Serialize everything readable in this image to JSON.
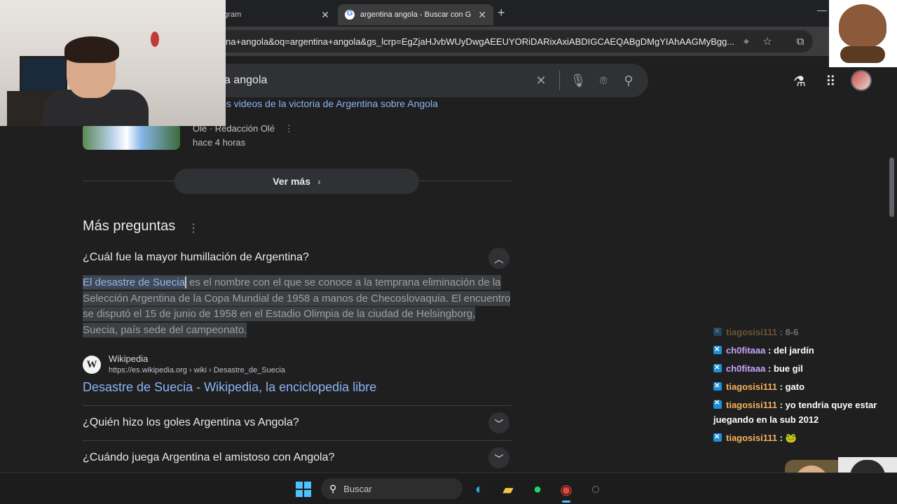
{
  "browser": {
    "tabs": [
      {
        "label": "tagram",
        "active": false
      },
      {
        "label": "argentina angola - Buscar con G",
        "active": true
      }
    ],
    "url": "na+angola&oq=argentina+angola&gs_lcrp=EgZjaHJvbWUyDwgAEEUYORiDARixAxiABDIGCAEQABgDMgYIAhAAGMyBgg..."
  },
  "google": {
    "query": "a angola"
  },
  "news": {
    "link_text": "los videos de la victoria de Argentina sobre Angola",
    "source": "Olé · Redacción Olé",
    "time": "hace 4 horas",
    "more_label": "Ver más"
  },
  "faq": {
    "title": "Más preguntas",
    "questions": [
      {
        "text": "¿Cuál fue la mayor humillación de Argentina?",
        "expanded": true
      },
      {
        "text": "¿Quién hizo los goles Argentina vs Angola?",
        "expanded": false
      },
      {
        "text": "¿Cuándo juega Argentina el amistoso con Angola?",
        "expanded": false
      }
    ],
    "answer_highlight": "El desastre de Suecia",
    "answer_rest": " es el nombre con el que se conoce a la temprana eliminación de la Selección Argentina de la Copa Mundial de 1958 a manos de Checoslovaquia. El encuentro se disputó el 15 de junio de 1958 en el Estadio Olimpia de la ciudad de Helsingborg, Suecia, país sede del campeonato.",
    "source": {
      "name": "Wikipedia",
      "url": "https://es.wikipedia.org › wiki › Desastre_de_Suecia",
      "title": "Desastre de Suecia - Wikipedia, la enciclopedia libre"
    }
  },
  "chat": [
    {
      "user": "tiagosisi111",
      "message": "8-6",
      "faded": true
    },
    {
      "user": "ch0fitaaa",
      "message": "del jardín"
    },
    {
      "user": "ch0fitaaa",
      "message": "bue gil"
    },
    {
      "user": "tiagosisi111",
      "message": "gato"
    },
    {
      "user": "tiagosisi111",
      "message": "yo tendria quye estar juegando en la sub 2012"
    },
    {
      "user": "tiagosisi111",
      "message": "🐸"
    }
  ],
  "taskbar": {
    "search_placeholder": "Buscar"
  }
}
